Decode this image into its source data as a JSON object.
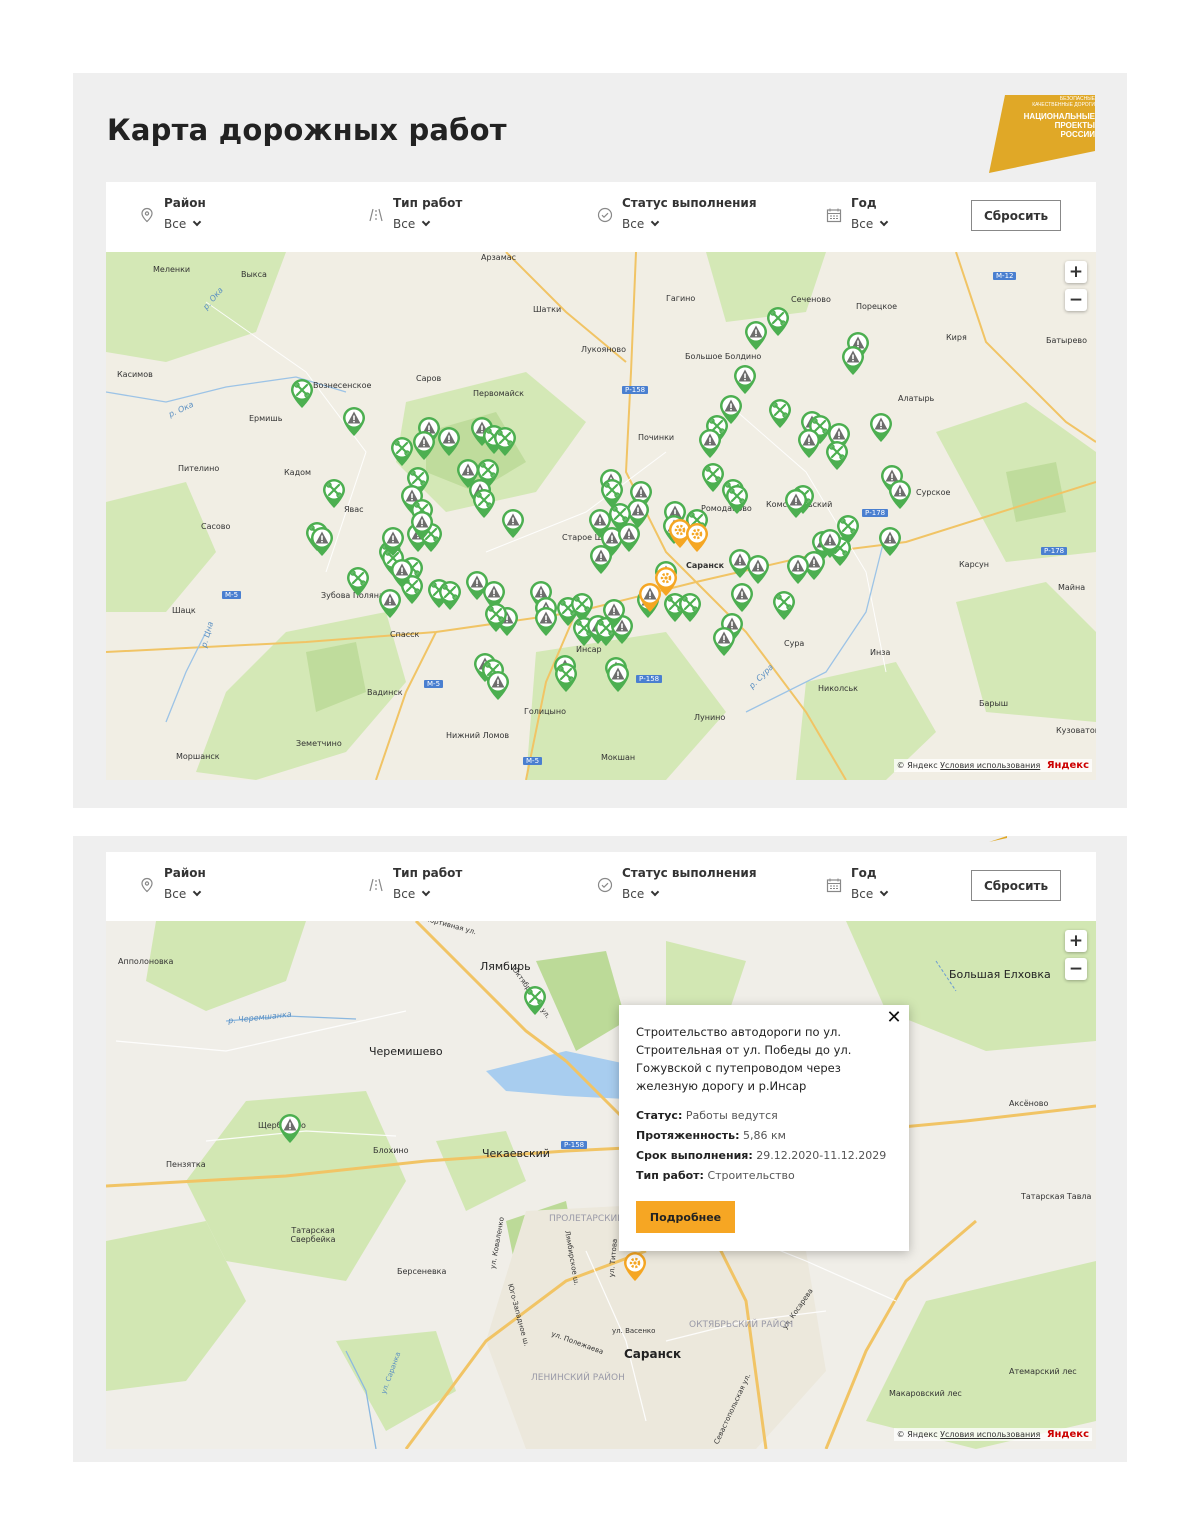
{
  "page": {
    "title": "Карта дорожных работ",
    "logo": {
      "line1": "БЕЗОПАСНЫЕ",
      "line2": "КАЧЕСТВЕННЫЕ ДОРОГИ",
      "line3": "НАЦИОНАЛЬНЫЕ",
      "line4": "ПРОЕКТЫ",
      "line5": "РОССИИ"
    }
  },
  "filters": {
    "district": {
      "label": "Район",
      "value": "Все"
    },
    "work_type": {
      "label": "Тип работ",
      "value": "Все"
    },
    "status": {
      "label": "Статус выполнения",
      "value": "Все"
    },
    "year": {
      "label": "Год",
      "value": "Все"
    },
    "reset_label": "Сбросить"
  },
  "map_controls": {
    "zoom_in": "+",
    "zoom_out": "−"
  },
  "attribution": {
    "prefix": "© Яндекс",
    "terms": "Условия использования",
    "logo": "Яндекс"
  },
  "map1": {
    "places": [
      "Меленки",
      "Выкса",
      "Арзамас",
      "Гагино",
      "Сеченово",
      "Порецкое",
      "Шатки",
      "Киря",
      "Батырево",
      "Лукояново",
      "Большое Болдино",
      "Касимов",
      "Вознесенское",
      "Саров",
      "Первомайск",
      "Ермишь",
      "Алатырь",
      "Починки",
      "Пителино",
      "Кадом",
      "Сурское",
      "Сасово",
      "Явас",
      "Старое Шайгово",
      "Саранск",
      "Ромоданово",
      "Комсомольский",
      "Карсун",
      "Майна",
      "Шацк",
      "Зубова Поляна",
      "Спасск",
      "Инсар",
      "Сура",
      "Инза",
      "Вадинск",
      "Николськ",
      "Барыш",
      "Голицыно",
      "Лунино",
      "Кузоватово",
      "Земетчино",
      "Нижний Ломов",
      "Моршанск",
      "Мокшан"
    ],
    "roads": [
      "Р-158",
      "М-12",
      "Р-178",
      "М-5"
    ],
    "rivers": [
      "р. Ока",
      "р. Цна",
      "р. Сура"
    ]
  },
  "map2": {
    "places": [
      "Апполоновка",
      "Лямбирь",
      "Черемишево",
      "Большая Елховка",
      "Аксёново",
      "Щербаково",
      "Блохино",
      "Чекаевский",
      "Пензятка",
      "Татарская Тавла",
      "Татарская Свербейка",
      "Берсеневка",
      "Саранск",
      "Атемарский лес",
      "Макаровский лес"
    ],
    "streets": [
      "Спортивная ул.",
      "Октябрьская ул.",
      "ул. Коваленко",
      "Лямбирское ш.",
      "ул. Титова",
      "ул. Косарева",
      "Юго-Западное ш.",
      "ул. Полежаева",
      "ул. Васенко",
      "Севастопольская ул.",
      "ул. Саранка"
    ],
    "districts": [
      "ПРОЛЕТАРСКИЙ РАЙОН",
      "ОКТЯБРЬСКИЙ РАЙОН",
      "ЛЕНИНСКИЙ РАЙОН"
    ],
    "rivers": [
      "р. Черемшанка"
    ],
    "roads": [
      "Р-158"
    ],
    "popup": {
      "title": "Строительство автодороги по ул. Строительная от ул. Победы до ул. Гожувской с путепроводом через железную дорогу и р.Инсар",
      "status_label": "Статус:",
      "status_value": "Работы ведутся",
      "length_label": "Протяженность:",
      "length_value": "5,86 км",
      "deadline_label": "Срок выполнения:",
      "deadline_value": "29.12.2020-11.12.2029",
      "type_label": "Тип работ:",
      "type_value": "Строительство",
      "more_label": "Подробнее"
    }
  },
  "colors": {
    "marker_green": "#4caf50",
    "marker_orange": "#f5a623",
    "button_orange": "#f6a623",
    "logo_gold": "#e0a827"
  }
}
